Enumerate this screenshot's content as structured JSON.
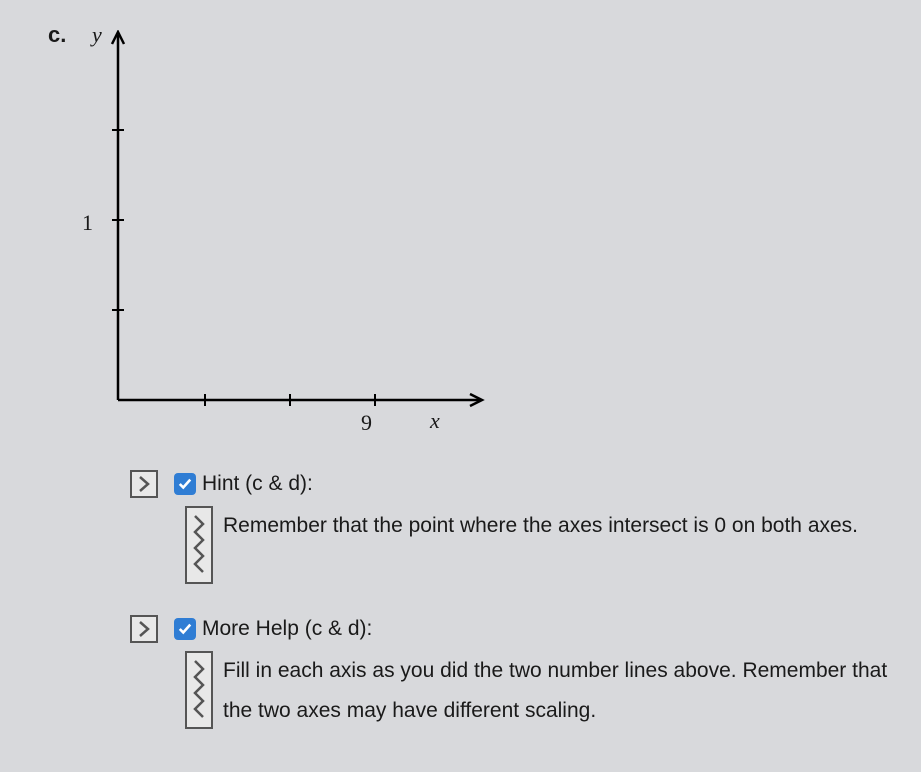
{
  "question": {
    "label": "c.",
    "y_axis_label": "y",
    "x_axis_label": "x"
  },
  "chart_data": {
    "type": "line",
    "title": "",
    "xlabel": "x",
    "ylabel": "y",
    "x_ticks": [
      3,
      6,
      9
    ],
    "y_ticks": [
      1,
      2,
      3
    ],
    "x_tick_labels": [
      "",
      "",
      "9"
    ],
    "y_tick_labels": [
      "",
      "1",
      ""
    ],
    "xlim": [
      0,
      12
    ],
    "ylim": [
      0,
      3.5
    ],
    "series": []
  },
  "hint": {
    "title": "Hint (c & d):",
    "text": "Remember that the point where the axes intersect is 0 on both axes."
  },
  "more_help": {
    "title": "More Help (c & d):",
    "text": "Fill in each axis as you did the two number lines above. Remember that the two axes may have different scaling."
  }
}
